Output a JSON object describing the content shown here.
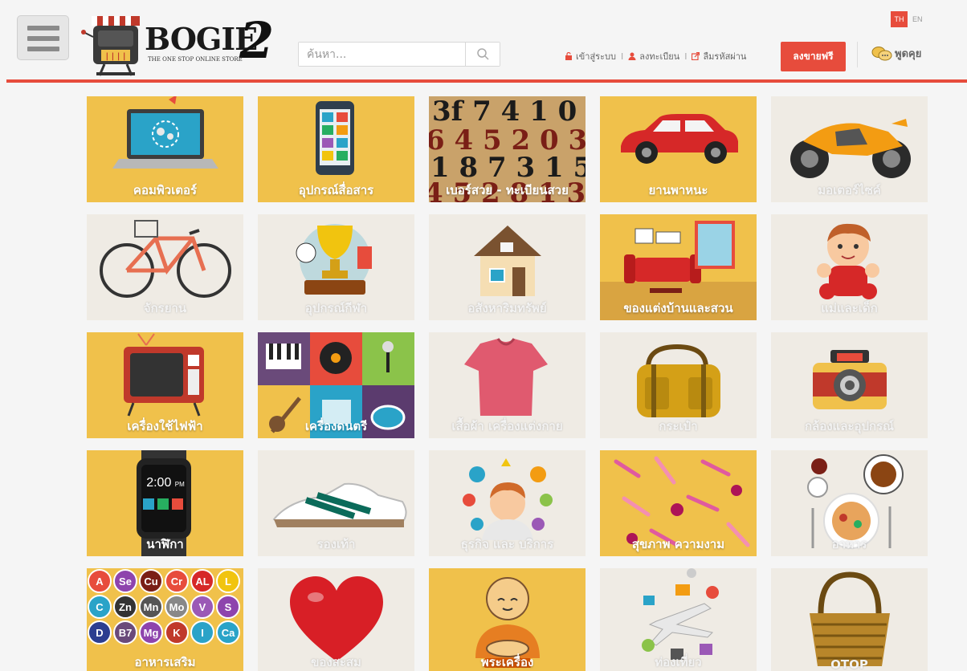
{
  "header": {
    "logo_text": "BOGIE",
    "logo_number": "2",
    "logo_tagline": "THE ONE STOP ONLINE STORE",
    "search_placeholder": "ค้นหา...",
    "lang": {
      "th": "TH",
      "en": "EN"
    },
    "login_label": "เข้าสู่ระบบ",
    "register_label": "ลงทะเบียน",
    "forgot_label": "ลืมรหัสผ่าน",
    "separator": "I",
    "sell_label": "ลงขายฟรี",
    "chat_label": "พูดคุย"
  },
  "colors": {
    "accent": "#e74c3c",
    "tile_yellow": "#f0c14b",
    "tile_light": "#efebe4"
  },
  "categories": [
    {
      "label": "คอมพิวเตอร์",
      "icon": "laptop-icon",
      "bg": "yellow"
    },
    {
      "label": "อุปกรณ์สื่อสาร",
      "icon": "smartphone-icon",
      "bg": "yellow"
    },
    {
      "label": "เบอร์สวย - ทะเบียนสวย",
      "icon": "numbers-icon",
      "bg": "dark"
    },
    {
      "label": "ยานพาหนะ",
      "icon": "car-icon",
      "bg": "yellow"
    },
    {
      "label": "มอเตอร์ไซค์",
      "icon": "motorcycle-icon",
      "bg": "light"
    },
    {
      "label": "จักรยาน",
      "icon": "bicycle-icon",
      "bg": "light"
    },
    {
      "label": "อุปกรณ์กีฬา",
      "icon": "trophy-icon",
      "bg": "light"
    },
    {
      "label": "อสังหาริมทรัพย์",
      "icon": "house-icon",
      "bg": "light"
    },
    {
      "label": "ของแต่งบ้านและสวน",
      "icon": "living-room-icon",
      "bg": "yellow"
    },
    {
      "label": "แม่และเด็ก",
      "icon": "baby-icon",
      "bg": "light"
    },
    {
      "label": "เครื่องใช้ไฟฟ้า",
      "icon": "tv-icon",
      "bg": "yellow"
    },
    {
      "label": "เครื่องดนตรี",
      "icon": "music-icon",
      "bg": "mosaic"
    },
    {
      "label": "เสื้อผ้า เครื่องแต่งกาย",
      "icon": "tshirt-icon",
      "bg": "light"
    },
    {
      "label": "กระเป๋า",
      "icon": "bag-icon",
      "bg": "light"
    },
    {
      "label": "กล้องและอุปกรณ์",
      "icon": "camera-icon",
      "bg": "light"
    },
    {
      "label": "นาฬิกา",
      "icon": "smartwatch-icon",
      "bg": "yellow",
      "text": "2:00",
      "sub": "PM"
    },
    {
      "label": "รองเท้า",
      "icon": "shoe-icon",
      "bg": "light"
    },
    {
      "label": "ธุรกิจ และ บริการ",
      "icon": "business-icon",
      "bg": "light"
    },
    {
      "label": "สุขภาพ ความงาม",
      "icon": "cosmetics-icon",
      "bg": "yellow"
    },
    {
      "label": "อาหาร",
      "icon": "food-icon",
      "bg": "light"
    },
    {
      "label": "อาหารเสริม",
      "icon": "supplements-icon",
      "bg": "yellow",
      "elements": [
        "A",
        "Se",
        "Cu",
        "Cr",
        "AL",
        "L",
        "C",
        "Zn",
        "Mn",
        "Mo",
        "V",
        "S",
        "D",
        "B7",
        "Mg",
        "K",
        "I",
        "Ca"
      ]
    },
    {
      "label": "ของสะสม",
      "icon": "heart-icon",
      "bg": "light"
    },
    {
      "label": "พระเครื่อง",
      "icon": "monk-icon",
      "bg": "yellow"
    },
    {
      "label": "ท่องเที่ยว",
      "icon": "travel-icon",
      "bg": "light"
    },
    {
      "label": "OTOP",
      "icon": "basket-icon",
      "bg": "light"
    }
  ]
}
